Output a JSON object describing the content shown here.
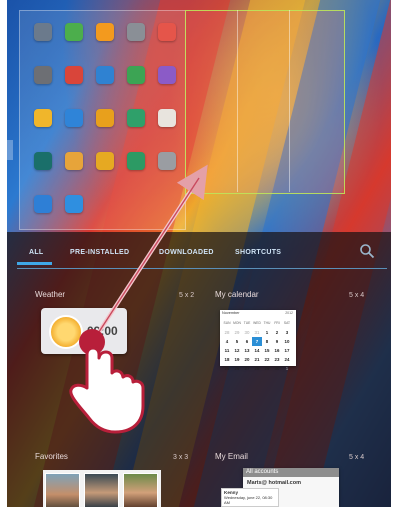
{
  "apps": [
    {
      "icon": "contacts-icon",
      "color": "#6b7a8c"
    },
    {
      "icon": "messaging-icon",
      "color": "#4cae4c"
    },
    {
      "icon": "home-icon",
      "color": "#f39a1e"
    },
    {
      "icon": "camera-icon",
      "color": "#8a8f96"
    },
    {
      "icon": "gallery-icon",
      "color": "#e5554a"
    },
    {
      "icon": "calendar-icon",
      "color": "#6d6f74"
    },
    {
      "icon": "gmail-icon",
      "color": "#d9453a"
    },
    {
      "icon": "sync-icon",
      "color": "#2f82d2"
    },
    {
      "icon": "maps-icon",
      "color": "#3ca454"
    },
    {
      "icon": "download-icon",
      "color": "#8b5bc7"
    },
    {
      "icon": "drive-icon",
      "color": "#f0b62b"
    },
    {
      "icon": "email-icon",
      "color": "#2f84d8"
    },
    {
      "icon": "folder-icon",
      "color": "#e8a01c"
    },
    {
      "icon": "music-icon",
      "color": "#2fa06a"
    },
    {
      "icon": "notes-icon",
      "color": "#e8e4de"
    },
    {
      "icon": "globe-icon",
      "color": "#1a6f6a"
    },
    {
      "icon": "list-icon",
      "color": "#e7a43a"
    },
    {
      "icon": "memo-icon",
      "color": "#e6a922"
    },
    {
      "icon": "video-icon",
      "color": "#2c9a64"
    },
    {
      "icon": "settings-icon",
      "color": "#9a9da2"
    },
    {
      "icon": "voice-icon",
      "color": "#2e7fd6"
    },
    {
      "icon": "store-icon",
      "color": "#2f8fe0"
    }
  ],
  "tabs": [
    "ALL",
    "PRE-INSTALLED",
    "DOWNLOADED",
    "SHORTCUTS"
  ],
  "widgets": {
    "weather": {
      "label": "Weather",
      "size": "5 x 2",
      "time": "09:00"
    },
    "calendar": {
      "label": "My calendar",
      "size": "5 x 4",
      "month": "November",
      "year": "2012",
      "days": [
        "SUN",
        "MON",
        "TUE",
        "WED",
        "THU",
        "FRI",
        "SAT"
      ],
      "weeks": [
        [
          "28",
          "29",
          "30",
          "31",
          "1",
          "2",
          "3"
        ],
        [
          "4",
          "5",
          "6",
          "7",
          "8",
          "9",
          "10"
        ],
        [
          "11",
          "12",
          "13",
          "14",
          "15",
          "16",
          "17"
        ],
        [
          "18",
          "19",
          "20",
          "21",
          "22",
          "23",
          "24"
        ],
        [
          "25",
          "26",
          "27",
          "28",
          "29",
          "30",
          "1"
        ]
      ]
    },
    "favorites": {
      "label": "Favorites",
      "size": "3 x 3"
    },
    "email": {
      "label": "My Email",
      "size": "5 x 4",
      "title": "All accounts",
      "account": "Marts@ hotmail.com",
      "preview_name": "Kenny",
      "preview_date": "Wednesday, june 22, 08:30 AM"
    }
  },
  "colors": {
    "accent": "#3fa8e8",
    "today": "#2b8fd6",
    "touch": "#b81f3a"
  }
}
